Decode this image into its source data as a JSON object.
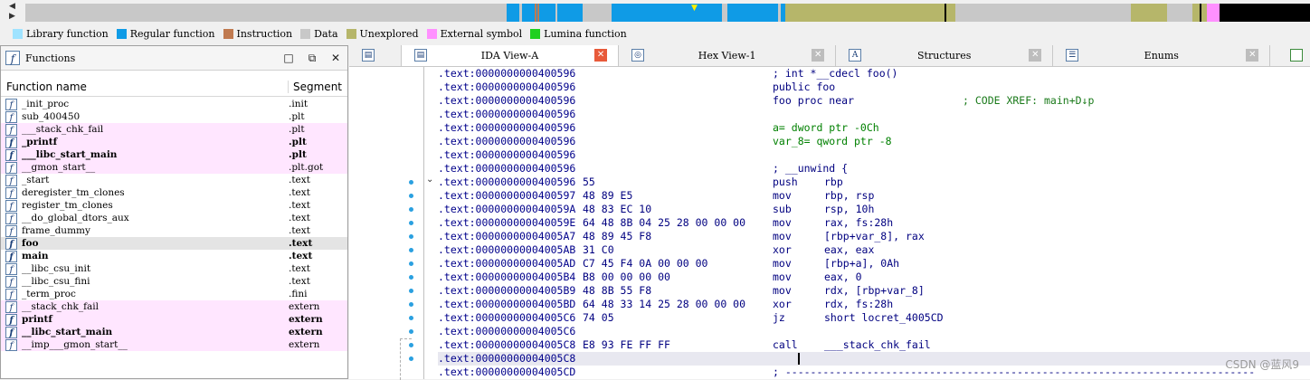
{
  "nav_colors": {
    "regular": "#0f9be6",
    "data": "#c8c8c8",
    "unexplored": "#b6b66a",
    "external": "#ff90ff",
    "black": "#000000",
    "instruction": "#c07a50",
    "library": "#9fe3ff",
    "lumina": "#20d020"
  },
  "legend": [
    {
      "label": "Library function",
      "color": "#9fe3ff"
    },
    {
      "label": "Regular function",
      "color": "#0f9be6"
    },
    {
      "label": "Instruction",
      "color": "#c07a50"
    },
    {
      "label": "Data",
      "color": "#c8c8c8"
    },
    {
      "label": "Unexplored",
      "color": "#b6b66a"
    },
    {
      "label": "External symbol",
      "color": "#ff90ff"
    },
    {
      "label": "Lumina function",
      "color": "#20d020"
    }
  ],
  "functions_panel": {
    "title": "Functions",
    "col_name": "Function name",
    "col_segment": "Segment",
    "rows": [
      {
        "name": "_init_proc",
        "segment": ".init",
        "style": ""
      },
      {
        "name": "sub_400450",
        "segment": ".plt",
        "style": ""
      },
      {
        "name": "___stack_chk_fail",
        "segment": ".plt",
        "style": "pink"
      },
      {
        "name": "_printf",
        "segment": ".plt",
        "style": "pink bold"
      },
      {
        "name": "___libc_start_main",
        "segment": ".plt",
        "style": "pink bold"
      },
      {
        "name": "__gmon_start__",
        "segment": ".plt.got",
        "style": "pink"
      },
      {
        "name": "_start",
        "segment": ".text",
        "style": ""
      },
      {
        "name": "deregister_tm_clones",
        "segment": ".text",
        "style": ""
      },
      {
        "name": "register_tm_clones",
        "segment": ".text",
        "style": ""
      },
      {
        "name": "__do_global_dtors_aux",
        "segment": ".text",
        "style": ""
      },
      {
        "name": "frame_dummy",
        "segment": ".text",
        "style": ""
      },
      {
        "name": "foo",
        "segment": ".text",
        "style": "sel bold"
      },
      {
        "name": "main",
        "segment": ".text",
        "style": "bold"
      },
      {
        "name": "__libc_csu_init",
        "segment": ".text",
        "style": ""
      },
      {
        "name": "__libc_csu_fini",
        "segment": ".text",
        "style": ""
      },
      {
        "name": "_term_proc",
        "segment": ".fini",
        "style": ""
      },
      {
        "name": "__stack_chk_fail",
        "segment": "extern",
        "style": "pink"
      },
      {
        "name": "printf",
        "segment": "extern",
        "style": "pink bold"
      },
      {
        "name": "__libc_start_main",
        "segment": "extern",
        "style": "pink bold"
      },
      {
        "name": "__imp___gmon_start__",
        "segment": "extern",
        "style": "pink"
      }
    ]
  },
  "tabs": [
    {
      "label": "IDA View-A",
      "icon": "ida-view-icon",
      "glyph": "▤",
      "active": true
    },
    {
      "label": "Hex View-1",
      "icon": "hex-view-icon",
      "glyph": "◎",
      "active": false
    },
    {
      "label": "Structures",
      "icon": "structures-icon",
      "glyph": "A",
      "active": false
    },
    {
      "label": "Enums",
      "icon": "enums-icon",
      "glyph": "☰",
      "active": false
    }
  ],
  "listing": [
    {
      "addr": ".text:0000000000400596",
      "bytes": "",
      "mnem": "",
      "ops": "",
      "text": "; int *__cdecl foo()",
      "cls": ""
    },
    {
      "addr": ".text:0000000000400596",
      "bytes": "",
      "mnem": "",
      "ops": "",
      "text": "public foo",
      "cls": ""
    },
    {
      "addr": ".text:0000000000400596",
      "bytes": "",
      "mnem": "",
      "ops": "",
      "text": "foo proc near",
      "comment": "; CODE XREF: main+D↓p",
      "cls": ""
    },
    {
      "addr": ".text:0000000000400596",
      "bytes": "",
      "mnem": "",
      "ops": "",
      "text": "",
      "cls": ""
    },
    {
      "addr": ".text:0000000000400596",
      "bytes": "",
      "mnem": "",
      "ops": "",
      "text": "a= dword ptr -0Ch",
      "cls": ""
    },
    {
      "addr": ".text:0000000000400596",
      "bytes": "",
      "mnem": "",
      "ops": "",
      "text": "var_8= qword ptr -8",
      "cls": ""
    },
    {
      "addr": ".text:0000000000400596",
      "bytes": "",
      "mnem": "",
      "ops": "",
      "text": "",
      "cls": ""
    },
    {
      "addr": ".text:0000000000400596",
      "bytes": "",
      "mnem": "",
      "ops": "",
      "text": "; __unwind {",
      "cls": ""
    },
    {
      "addr": ".text:0000000000400596",
      "bytes": "55",
      "mnem": "push",
      "ops": "rbp",
      "text": "",
      "cls": ""
    },
    {
      "addr": ".text:0000000000400597",
      "bytes": "48 89 E5",
      "mnem": "mov",
      "ops": "rbp, rsp",
      "text": "",
      "cls": ""
    },
    {
      "addr": ".text:000000000040059A",
      "bytes": "48 83 EC 10",
      "mnem": "sub",
      "ops": "rsp, 10h",
      "text": "",
      "cls": ""
    },
    {
      "addr": ".text:000000000040059E",
      "bytes": "64 48 8B 04 25 28 00 00 00",
      "mnem": "mov",
      "ops": "rax, fs:28h",
      "text": "",
      "cls": ""
    },
    {
      "addr": ".text:00000000004005A7",
      "bytes": "48 89 45 F8",
      "mnem": "mov",
      "ops": "[rbp+var_8], rax",
      "text": "",
      "cls": ""
    },
    {
      "addr": ".text:00000000004005AB",
      "bytes": "31 C0",
      "mnem": "xor",
      "ops": "eax, eax",
      "text": "",
      "cls": ""
    },
    {
      "addr": ".text:00000000004005AD",
      "bytes": "C7 45 F4 0A 00 00 00",
      "mnem": "mov",
      "ops": "[rbp+a], 0Ah",
      "text": "",
      "cls": ""
    },
    {
      "addr": ".text:00000000004005B4",
      "bytes": "B8 00 00 00 00",
      "mnem": "mov",
      "ops": "eax, 0",
      "text": "",
      "cls": ""
    },
    {
      "addr": ".text:00000000004005B9",
      "bytes": "48 8B 55 F8",
      "mnem": "mov",
      "ops": "rdx, [rbp+var_8]",
      "text": "",
      "cls": ""
    },
    {
      "addr": ".text:00000000004005BD",
      "bytes": "64 48 33 14 25 28 00 00 00",
      "mnem": "xor",
      "ops": "rdx, fs:28h",
      "text": "",
      "cls": ""
    },
    {
      "addr": ".text:00000000004005C6",
      "bytes": "74 05",
      "mnem": "jz",
      "ops": "short locret_4005CD",
      "text": "",
      "cls": ""
    },
    {
      "addr": ".text:00000000004005C6",
      "bytes": "",
      "mnem": "",
      "ops": "",
      "text": "",
      "cls": ""
    },
    {
      "addr": ".text:00000000004005C8",
      "bytes": "E8 93 FE FF FF",
      "mnem": "call",
      "ops": "___stack_chk_fail",
      "text": "",
      "cls": ""
    },
    {
      "addr": ".text:00000000004005C8",
      "bytes": "",
      "mnem": "",
      "ops": "",
      "text": "",
      "cls": "hl"
    },
    {
      "addr": ".text:00000000004005CD",
      "bytes": "",
      "mnem": "",
      "ops": "",
      "text": "; ---------------------------------------------------------------------------",
      "cls": ""
    }
  ],
  "watermark": "CSDN @蓝风9"
}
